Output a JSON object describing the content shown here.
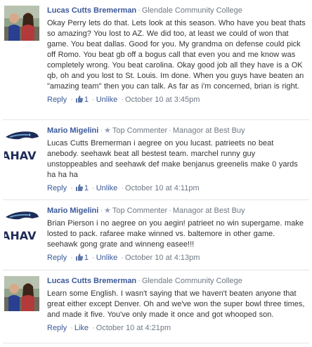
{
  "comments": [
    {
      "author": "Lucas Cutts Bremerman",
      "affiliation": "Glendale Community College",
      "badge": "",
      "avatar": "person",
      "text": "Okay Perry lets do that. Lets look at this season. Who have you beat thats so amazing? You lost to AZ. We did too, at least we could of won that game. You beat dallas. Good for you. My grandma on defense could pick off Romo. You beat gb off a bogus call that even you and me know was completely wrong. You beat carolina. Okay good job all they have is a OK qb, oh and you lost to St. Louis. Im done. When you guys have beaten an \"amazing team\" then you can talk. As far as i'm concerned, brian is right.",
      "reply_label": "Reply",
      "like_count": "1",
      "like_label": "Unlike",
      "time": "October 10 at 3:45pm"
    },
    {
      "author": "Mario Migelini",
      "affiliation": "Managor at Best Buy",
      "badge": "Top Commenter",
      "avatar": "seahawks",
      "text": "Lucas Cutts Bremerman i aegree on you lucast. patrieets no beat anebody. seehawk beat all bestest team. marchel runny guy unstoppeables and seehawk def make benjanus greenelis make 0 yards ha ha ha",
      "reply_label": "Reply",
      "like_count": "1",
      "like_label": "Unlike",
      "time": "October 10 at 4:11pm"
    },
    {
      "author": "Mario Migelini",
      "affiliation": "Managor at Best Buy",
      "badge": "Top Commenter",
      "avatar": "seahawks",
      "text": "Brian Pierson i no aegree on you aegin! patrieet no win supergame. make losted to pack. rafaree make winned vs. baltemore in other game. seehawk gong grate and winneng easee!!!",
      "reply_label": "Reply",
      "like_count": "1",
      "like_label": "Unlike",
      "time": "October 10 at 4:13pm"
    },
    {
      "author": "Lucas Cutts Bremerman",
      "affiliation": "Glendale Community College",
      "badge": "",
      "avatar": "person",
      "text": "Learn some English. I wasn't saying that we haven't beaten anyone that great either except Denver. Oh and we've won the super bowl three times, and made it five. You've only made it once and got whooped son.",
      "reply_label": "Reply",
      "like_count": "",
      "like_label": "Like",
      "time": "October 10 at 4:21pm"
    }
  ]
}
